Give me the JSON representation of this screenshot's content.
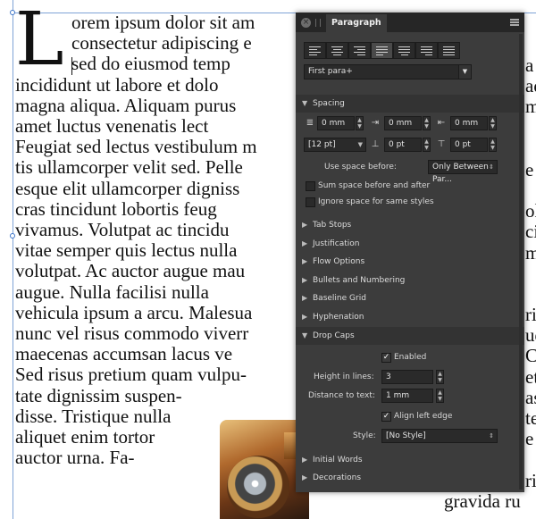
{
  "document": {
    "drop_cap": "L",
    "lines": [
      "orem ipsum dolor sit am",
      "consectetur adipiscing e",
      "sed do eiusmod temp",
      "incididunt ut labore et dolo",
      "magna aliqua. Aliquam purus",
      "amet luctus venenatis lect",
      "Feugiat sed lectus vestibulum m",
      "tis ullamcorper velit sed. Pelle",
      "esque elit ullamcorper digniss",
      "cras tincidunt lobortis feug",
      "vivamus. Volutpat ac tincidu",
      "vitae semper quis lectus nulla",
      "volutpat. Ac auctor augue mau",
      "augue. Nulla facilisi nulla",
      "vehicula ipsum a arcu. Malesua",
      "nunc vel risus commodo viverr",
      "maecenas accumsan lacus ve",
      "Sed risus pretium quam vulpu-",
      "tate dignissim suspen-",
      "disse. Tristique nulla",
      "aliquet enim tortor",
      "auctor urna. Fa-"
    ],
    "right_fragments": [
      "a",
      "adi",
      "me",
      "e",
      "olu",
      "ci",
      "ma",
      "ric",
      "ue",
      "C",
      "et",
      "as",
      "ter",
      "e",
      "ris",
      "gravida ru"
    ]
  },
  "panel": {
    "tab_label": "Paragraph",
    "alignment_buttons": [
      "align-left",
      "align-center",
      "align-right",
      "justify-left",
      "justify-center",
      "justify-right",
      "justify-all"
    ],
    "paragraph_style": "First para+",
    "sections": {
      "spacing": "Spacing",
      "tab_stops": "Tab Stops",
      "justification": "Justification",
      "flow_options": "Flow Options",
      "bullets": "Bullets and Numbering",
      "baseline_grid": "Baseline Grid",
      "hyphenation": "Hyphenation",
      "drop_caps": "Drop Caps",
      "initial_words": "Initial Words",
      "decorations": "Decorations"
    },
    "spacing": {
      "left_indent": "0 mm",
      "first_line_indent": "0 mm",
      "right_indent": "0 mm",
      "leading": "[12 pt]",
      "space_before": "0 pt",
      "space_after": "0 pt",
      "use_space_before_label": "Use space before:",
      "use_space_before_value": "Only Between Par...",
      "sum_space_label": "Sum space before and after",
      "ignore_space_label": "Ignore space for same styles"
    },
    "drop_caps": {
      "enabled_label": "Enabled",
      "height_label": "Height in lines:",
      "height_value": "3",
      "distance_label": "Distance to text:",
      "distance_value": "1 mm",
      "align_left_label": "Align left edge",
      "style_label": "Style:",
      "style_value": "[No Style]"
    },
    "colors": {
      "panel_bg": "#3c3c3c",
      "header_bg": "#262626",
      "field_bg": "#2a2a2a",
      "frame_line": "#7fa3d6"
    }
  }
}
